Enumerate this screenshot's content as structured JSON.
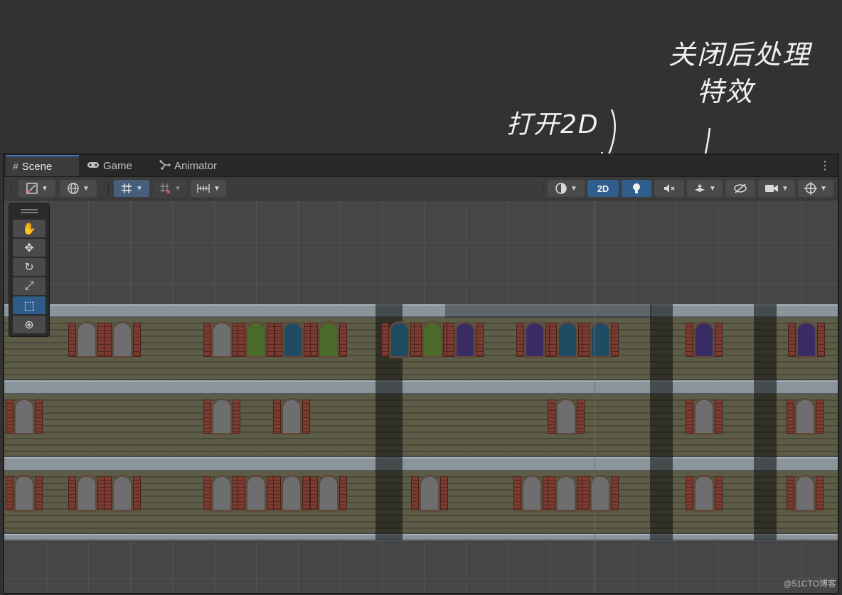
{
  "annotations": {
    "open_2d": "打开2D",
    "close_post_line1": "关闭后处理",
    "close_post_line2": "特效"
  },
  "tabs": [
    {
      "label": "Scene",
      "icon": "hash-icon",
      "active": true
    },
    {
      "label": "Game",
      "icon": "gamepad-icon",
      "active": false
    },
    {
      "label": "Animator",
      "icon": "animator-icon",
      "active": false
    }
  ],
  "toolbar": {
    "toggle_2d_label": "2D"
  },
  "tools": [
    "hand-tool",
    "move-tool",
    "rotate-tool",
    "scale-tool",
    "rect-tool",
    "transform-tool"
  ],
  "colors": {
    "accent": "#2f5d8c",
    "tab_highlight": "#3a79bb"
  },
  "watermark": "@51CTO博客"
}
